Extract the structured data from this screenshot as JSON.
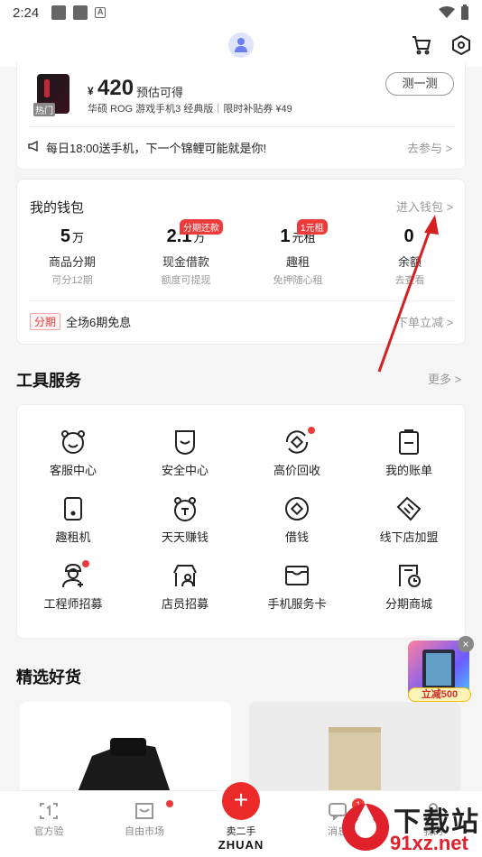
{
  "status_bar": {
    "time": "2:24",
    "notif_letter": "A"
  },
  "header": {
    "icons": [
      "avatar",
      "cart-icon",
      "settings-icon"
    ]
  },
  "promo": {
    "hot_tag": "热门",
    "price_symbol": "¥",
    "price": "420",
    "price_note": "预估可得",
    "description": "华硕 ROG 游戏手机3 经典版｜限时补贴券 ¥49",
    "test_button": "测一测",
    "banner_text": "每日18:00送手机，下一个锦鲤可能就是你!",
    "banner_link": "去参与 >"
  },
  "wallet": {
    "title": "我的钱包",
    "link": "进入钱包 >",
    "items": [
      {
        "value": "5",
        "unit": "万",
        "label": "商品分期",
        "sub": "可分12期",
        "badge": ""
      },
      {
        "value": "2.1",
        "unit": "万",
        "label": "现金借款",
        "sub": "额度可提现",
        "badge": "分期还款"
      },
      {
        "value": "1",
        "unit": "元租",
        "label": "趣租",
        "sub": "免押随心租",
        "badge": "1元租"
      },
      {
        "value": "0",
        "unit": "",
        "label": "余额",
        "sub": "去查看",
        "badge": ""
      }
    ],
    "installment_tag": "分期",
    "installment_text": "全场6期免息",
    "installment_link": "下单立减 >"
  },
  "tools": {
    "title": "工具服务",
    "more": "更多 >",
    "items": [
      {
        "label": "客服中心",
        "icon": "customer-service-icon",
        "dot": false
      },
      {
        "label": "安全中心",
        "icon": "security-icon",
        "dot": false
      },
      {
        "label": "高价回收",
        "icon": "recycle-icon",
        "dot": true
      },
      {
        "label": "我的账单",
        "icon": "bill-icon",
        "dot": false
      },
      {
        "label": "趣租机",
        "icon": "rental-phone-icon",
        "dot": false
      },
      {
        "label": "天天赚钱",
        "icon": "earn-money-icon",
        "dot": false
      },
      {
        "label": "借钱",
        "icon": "borrow-icon",
        "dot": false
      },
      {
        "label": "线下店加盟",
        "icon": "handshake-icon",
        "dot": false
      },
      {
        "label": "工程师招募",
        "icon": "engineer-icon",
        "dot": true
      },
      {
        "label": "店员招募",
        "icon": "clerk-icon",
        "dot": false
      },
      {
        "label": "手机服务卡",
        "icon": "service-card-icon",
        "dot": false
      },
      {
        "label": "分期商城",
        "icon": "installment-mall-icon",
        "dot": false
      }
    ]
  },
  "goods": {
    "title": "精选好货"
  },
  "float_promo": {
    "badge": "立减500",
    "close": "×"
  },
  "tabbar": {
    "tabs": [
      {
        "label": "官方验",
        "icon": "verified-icon"
      },
      {
        "label": "自由市场",
        "icon": "market-icon"
      },
      {
        "label": "卖二手",
        "icon": "sell-plus-icon"
      },
      {
        "label": "消息",
        "icon": "message-icon"
      },
      {
        "label": "我的",
        "icon": "profile-icon"
      }
    ],
    "sell_plus": "+",
    "brand": "ZHUAN",
    "message_badge": "1"
  },
  "watermark": {
    "line1": "下载站",
    "line2": "91xz.net"
  }
}
